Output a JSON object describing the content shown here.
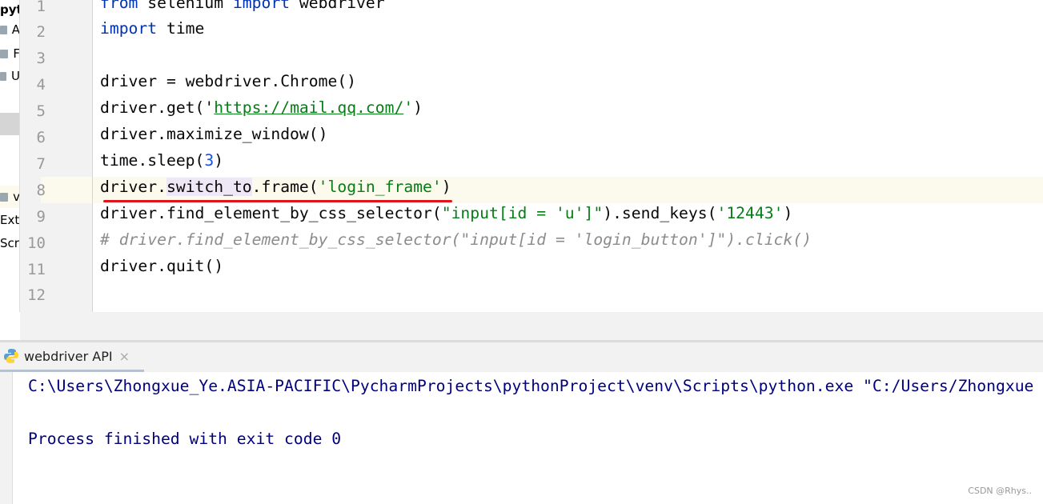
{
  "sidebar": {
    "items": [
      {
        "label": "pyth",
        "icon": ""
      },
      {
        "label": "A",
        "icon": "folder-icon"
      },
      {
        "label": "F",
        "icon": "folder-icon"
      },
      {
        "label": "U",
        "icon": "folder-icon"
      },
      {
        "label": "",
        "icon": "file-icon"
      },
      {
        "label": "",
        "icon": "file-icon"
      },
      {
        "label": "",
        "icon": "file-icon"
      },
      {
        "label": "",
        "icon": "file-icon"
      },
      {
        "label": "v",
        "icon": "folder-icon"
      },
      {
        "label": "Exte",
        "icon": ""
      },
      {
        "label": "Scra",
        "icon": ""
      }
    ]
  },
  "editor": {
    "current_line": 8,
    "lines": [
      [
        [
          "from",
          "kw"
        ],
        [
          " selenium ",
          ""
        ],
        [
          "import",
          "kw"
        ],
        [
          " webdriver",
          ""
        ]
      ],
      [
        [
          "import",
          "kw"
        ],
        [
          " time",
          ""
        ]
      ],
      [],
      [
        [
          "driver = webdriver.Chrome()",
          ""
        ]
      ],
      [
        [
          "driver.get(",
          ""
        ],
        [
          "'",
          ""
        ],
        [
          "https://mail.qq.com/",
          "url"
        ],
        [
          "'",
          "str"
        ],
        [
          ")",
          ""
        ]
      ],
      [
        [
          "driver.maximize_window()",
          ""
        ]
      ],
      [
        [
          "time.sleep(",
          ""
        ],
        [
          "3",
          "num"
        ],
        [
          ")",
          ""
        ]
      ],
      [
        [
          "driver.",
          ""
        ],
        [
          "switch_to",
          "sel"
        ],
        [
          ".frame(",
          ""
        ],
        [
          "'login_frame'",
          "str"
        ],
        [
          ")",
          ""
        ]
      ],
      [
        [
          "driver.find_element_by_css_selector(",
          ""
        ],
        [
          "\"input[id = 'u']\"",
          "str"
        ],
        [
          ").send_keys(",
          ""
        ],
        [
          "'12443'",
          "str"
        ],
        [
          ")",
          ""
        ]
      ],
      [
        [
          "# driver.find_element_by_css_selector(\"input[id = 'login_button']\").click()",
          "cm"
        ]
      ],
      [
        [
          "driver.quit()",
          ""
        ]
      ],
      []
    ]
  },
  "run_panel": {
    "tab_label": "webdriver API",
    "close_icon": "×",
    "output": [
      "C:\\Users\\Zhongxue_Ye.ASIA-PACIFIC\\PycharmProjects\\pythonProject\\venv\\Scripts\\python.exe \"C:/Users/Zhongxue",
      "",
      "Process finished with exit code 0"
    ]
  },
  "watermark": "CSDN @Rhys.."
}
